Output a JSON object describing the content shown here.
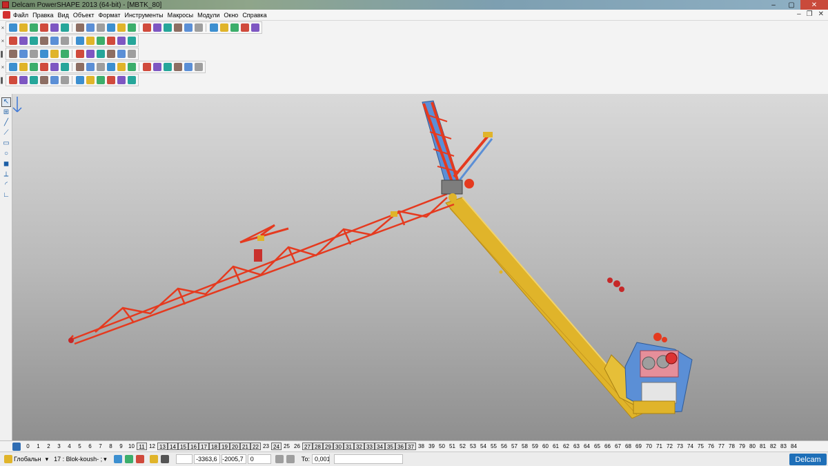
{
  "window": {
    "title": "Delcam PowerSHAPE 2013 (64-bit) - [MBTK_80]",
    "minimize": "–",
    "maximize": "▢",
    "close": "✕"
  },
  "menu": {
    "items": [
      "Файл",
      "Правка",
      "Вид",
      "Объект",
      "Формат",
      "Инструменты",
      "Макросы",
      "Модули",
      "Окно",
      "Справка"
    ],
    "mdi_minimize": "–",
    "mdi_restore": "❐",
    "mdi_close": "✕"
  },
  "toolbars": {
    "grip_close": "×",
    "grip_bar": "▌",
    "rows": [
      {
        "grip": "×",
        "icons": [
          "new-file",
          "open-file",
          "open-model",
          "save",
          "save-as",
          "print",
          "cut",
          "copy",
          "paste",
          "delete",
          "undo",
          "redo",
          "repeat",
          "measure",
          "transform",
          "lasso-select",
          "circle-select",
          "spline",
          "draw",
          "shade",
          "view-shaded",
          "view-wire",
          "tools"
        ]
      },
      {
        "grip": "×",
        "icons": [
          "view-iso1",
          "view-iso2",
          "view-front",
          "view-top",
          "zoom-in",
          "zoom-out",
          "zoom-all",
          "view-orbit",
          "shaded-sphere",
          "view-solid",
          "light",
          "hand-pan"
        ]
      },
      {
        "grip": "▌",
        "icons": [
          "workplane",
          "level",
          "grid",
          "snap",
          "sphere-red",
          "sphere-green",
          "arrow-green",
          "cube-yellow",
          "box",
          "boolean",
          "group",
          "mirror"
        ]
      },
      {
        "grip": "×",
        "icons": [
          "view-wire-off",
          "view-rect",
          "view-solid-box",
          "view-hidden",
          "view-undo",
          "view-redo",
          "view-copy",
          "view-surface1",
          "view-surface2",
          "view-surface3",
          "view-surface4",
          "view-dim",
          "view-blend1",
          "view-blend2",
          "view-blend3",
          "view-sect1",
          "view-sect2",
          "view-sect3"
        ]
      },
      {
        "grip": "▌",
        "icons": [
          "sphere-grey",
          "curve-x",
          "solid-cube",
          "solid-green",
          "solid-yellow",
          "solid-box",
          "solid-pair",
          "surface-yellow",
          "curves-multi",
          "shield-green",
          "gem-yellow",
          "gem-blue"
        ]
      }
    ]
  },
  "left_toolbar": {
    "icons": [
      "select-arrow",
      "multi-select",
      "line",
      "polyline",
      "rectangle",
      "circle",
      "solid",
      "dimension",
      "arc",
      "curve-edit"
    ]
  },
  "viewport": {
    "model_name": "MBTK_80",
    "colors": {
      "boom": "#e53a1f",
      "jib": "#e0b42a",
      "accent_blue": "#5b8fd6",
      "background_top": "#d9d9d9",
      "background_bottom": "#8f8f8f"
    }
  },
  "levels": {
    "numbers": [
      "0",
      "1",
      "2",
      "3",
      "4",
      "5",
      "6",
      "7",
      "8",
      "9",
      "10",
      "11",
      "12",
      "13",
      "14",
      "15",
      "16",
      "17",
      "18",
      "19",
      "20",
      "21",
      "22",
      "23",
      "24",
      "25",
      "26",
      "27",
      "28",
      "29",
      "30",
      "31",
      "32",
      "33",
      "34",
      "35",
      "36",
      "37",
      "38",
      "39",
      "50",
      "51",
      "52",
      "53",
      "54",
      "55",
      "56",
      "57",
      "58",
      "59",
      "60",
      "61",
      "62",
      "63",
      "64",
      "65",
      "66",
      "67",
      "68",
      "69",
      "70",
      "71",
      "72",
      "73",
      "74",
      "75",
      "76",
      "77",
      "78",
      "79",
      "80",
      "81",
      "82",
      "83",
      "84"
    ],
    "active": [
      "11",
      "13",
      "14",
      "15",
      "16",
      "17",
      "18",
      "19",
      "20",
      "21",
      "22",
      "24",
      "27",
      "28",
      "29",
      "30",
      "31",
      "32",
      "33",
      "34",
      "35",
      "36",
      "37"
    ]
  },
  "status": {
    "workplane": "Глобальн",
    "level": "17 : Blok-koush- ;",
    "x": "-3363,6",
    "y": "-2005,7",
    "z": "0",
    "tolerance_label": "То:",
    "tolerance": "0,001",
    "brand": "Delcam"
  }
}
